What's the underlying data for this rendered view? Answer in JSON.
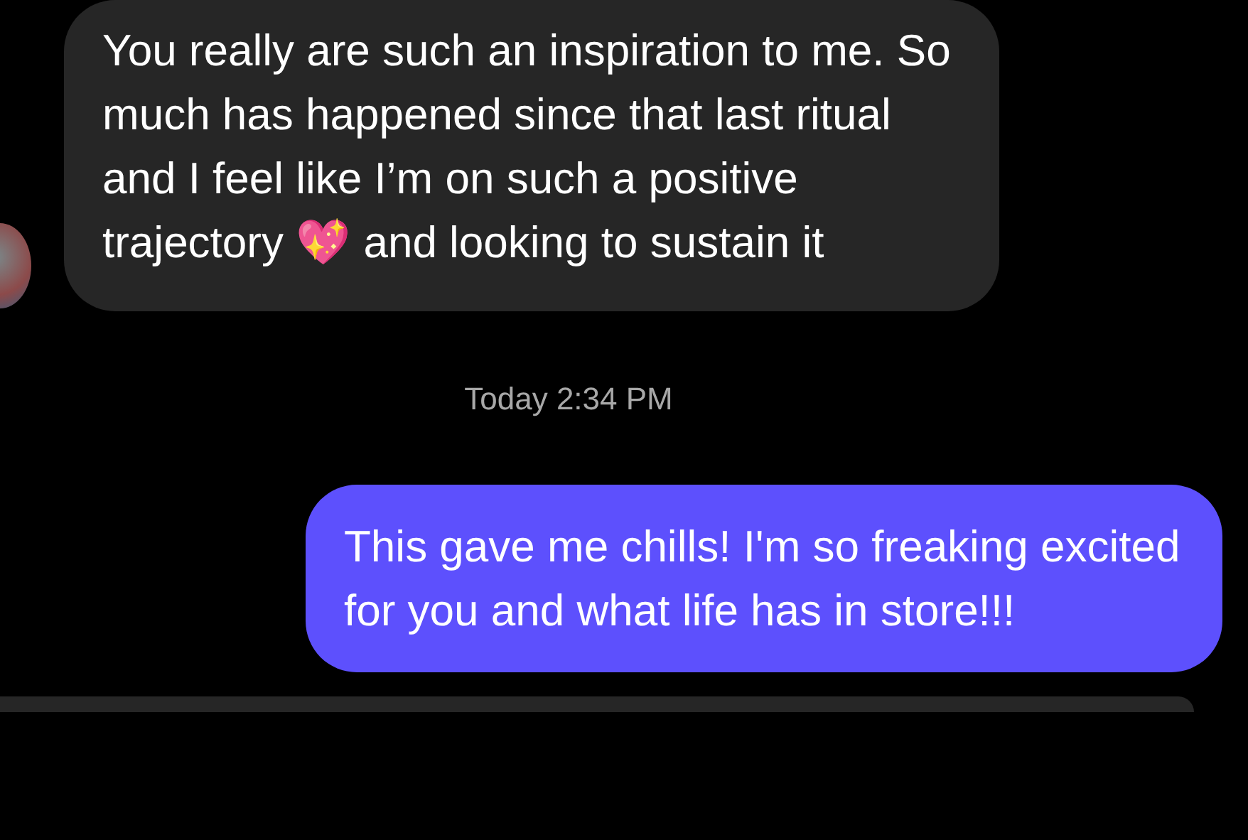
{
  "messages": [
    {
      "kind": "incoming",
      "text": "You really are such an inspiration to me. So much has happened since that last ritual and I feel like I’m on such a positive trajectory 💖 and looking to sustain it",
      "avatar": true
    },
    {
      "kind": "timestamp",
      "text": "Today 2:34 PM"
    },
    {
      "kind": "outgoing",
      "text": "This gave me chills! I'm so freaking excited for you and what life has in store!!!"
    }
  ]
}
